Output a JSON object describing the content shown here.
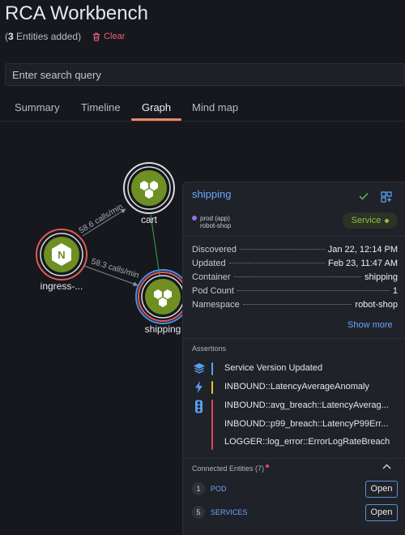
{
  "header": {
    "title": "RCA Workbench",
    "entities_count": "3",
    "entities_label": "Entities added)",
    "entities_open": "(",
    "clear_label": "Clear"
  },
  "search": {
    "placeholder": "Enter search query",
    "value": ""
  },
  "tabs": [
    {
      "label": "Summary",
      "active": false
    },
    {
      "label": "Timeline",
      "active": false
    },
    {
      "label": "Graph",
      "active": true
    },
    {
      "label": "Mind map",
      "active": false
    }
  ],
  "graph": {
    "nodes": [
      {
        "label": "cart",
        "icon": "hexagon-cluster-icon"
      },
      {
        "label": "ingress-...",
        "icon": "nginx-icon",
        "icon_text": "N"
      },
      {
        "label": "shipping",
        "icon": "hexagon-cluster-icon"
      }
    ],
    "edges": [
      {
        "label": "58.6 calls/min"
      },
      {
        "label": "58.3 calls/min"
      }
    ]
  },
  "panel": {
    "title": "shipping",
    "tag_app": "prod (app)",
    "tag_ns": "robot-shop",
    "badge": "Service",
    "properties": [
      {
        "key": "Discovered",
        "value": "Jan 22, 12:14 PM"
      },
      {
        "key": "Updated",
        "value": "Feb 23, 11:47 AM"
      },
      {
        "key": "Container",
        "value": "shipping"
      },
      {
        "key": "Pod Count",
        "value": "1"
      },
      {
        "key": "Namespace",
        "value": "robot-shop"
      }
    ],
    "show_more": "Show more",
    "assertions_label": "Assertions",
    "assertions": [
      {
        "text": "Service Version Updated",
        "color": "#5aa0f0"
      },
      {
        "text": "INBOUND::LatencyAverageAnomaly",
        "color": "#f0c030"
      },
      {
        "text": "INBOUND::avg_breach::LatencyAverag...",
        "color": "#e8455a"
      },
      {
        "text": "INBOUND::p99_breach::LatencyP99Err...",
        "color": "#e8455a"
      },
      {
        "text": "LOGGER::log_error::ErrorLogRateBreach",
        "color": "#e8455a"
      }
    ],
    "connected_label": "Connected Entities (7)",
    "connected": [
      {
        "count": "1",
        "name": "POD",
        "action": "Open"
      },
      {
        "count": "5",
        "name": "SERVICES",
        "action": "Open"
      }
    ]
  },
  "colors": {
    "accent_link": "#6aa6ff",
    "tab_underline": "#f0876b",
    "node_green": "#6e8f22",
    "clear_red": "#f0607a"
  }
}
